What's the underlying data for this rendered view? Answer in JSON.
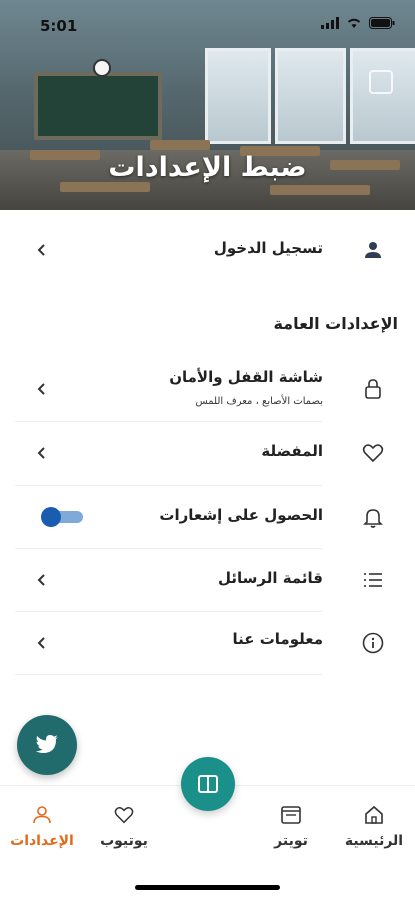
{
  "status_bar": {
    "time": "5:01"
  },
  "header": {
    "title": "ضبط الإعدادات"
  },
  "login": {
    "label": "تسجيل الدخول"
  },
  "general_section": {
    "title": "الإعدادات العامة"
  },
  "settings": {
    "lock_screen": {
      "label": "شاشة القفل والأمان",
      "sublabel": "بصمات الأصابع ، معرف اللمس"
    },
    "favorites": {
      "label": "المفضلة"
    },
    "notifications": {
      "label": "الحصول على إشعارات",
      "enabled": true
    },
    "messages": {
      "label": "قائمة الرسائل"
    },
    "about": {
      "label": "معلومات عنا"
    }
  },
  "tabs": {
    "home": "الرئيسية",
    "twitter": "تويتر",
    "youtube": "يوتيوب",
    "settings": "الإعدادات"
  },
  "colors": {
    "accent": "#e26a1a",
    "teal": "#1b8f8a",
    "fab": "#226b6c",
    "toggle": "#1a5db0"
  },
  "icons": [
    "user-icon",
    "lock-icon",
    "heart-icon",
    "bell-icon",
    "list-icon",
    "info-icon",
    "twitter-icon",
    "home-icon",
    "book-icon",
    "chevron-left-icon"
  ]
}
